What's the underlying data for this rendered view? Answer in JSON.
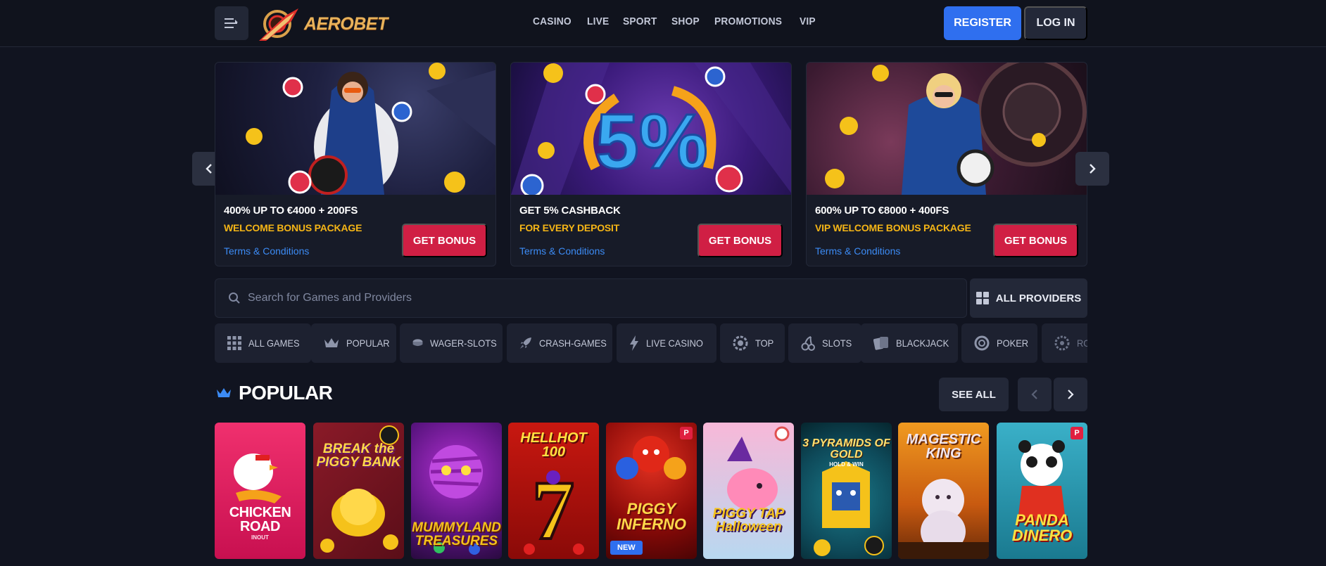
{
  "header": {
    "logo_text": "AEROBET",
    "nav": [
      "CASINO",
      "LIVE",
      "SPORT",
      "SHOP",
      "PROMOTIONS",
      "VIP"
    ],
    "register_label": "REGISTER",
    "login_label": "LOG IN"
  },
  "promos": [
    {
      "title": "400% UP TO €4000 + 200FS",
      "subtitle": "WELCOME BONUS PACKAGE",
      "terms": "Terms & Conditions",
      "button": "GET BONUS"
    },
    {
      "title": "GET 5% CASHBACK",
      "subtitle": "FOR EVERY DEPOSIT",
      "terms": "Terms & Conditions",
      "button": "GET BONUS",
      "image_text": "5%"
    },
    {
      "title": "600% UP TO €8000 + 400FS",
      "subtitle": "VIP WELCOME BONUS PACKAGE",
      "terms": "Terms & Conditions",
      "button": "GET BONUS"
    }
  ],
  "search": {
    "placeholder": "Search for Games and Providers"
  },
  "providers_label": "ALL PROVIDERS",
  "categories": [
    {
      "label": "ALL GAMES",
      "icon": "grid-icon"
    },
    {
      "label": "POPULAR",
      "icon": "crown-icon"
    },
    {
      "label": "WAGER-SLOTS",
      "icon": "coin-stack-icon"
    },
    {
      "label": "CRASH-GAMES",
      "icon": "rocket-icon"
    },
    {
      "label": "LIVE CASINO",
      "icon": "lightning-icon"
    },
    {
      "label": "TOP",
      "icon": "gear-badge-icon"
    },
    {
      "label": "SLOTS",
      "icon": "cherry-icon"
    },
    {
      "label": "BLACKJACK",
      "icon": "cards-icon"
    },
    {
      "label": "POKER",
      "icon": "chip-icon"
    },
    {
      "label": "RO",
      "icon": "roulette-icon"
    }
  ],
  "popular": {
    "title": "POPULAR",
    "see_all": "SEE ALL",
    "games": [
      {
        "name": "CHICKEN ROAD",
        "provider": "INOUT",
        "bg": "#e8246a"
      },
      {
        "name": "BREAK the PIGGY BANK",
        "bg": "#7a1420"
      },
      {
        "name": "MUMMYLAND TREASURES",
        "bg": "#4a1470"
      },
      {
        "name": "HELLHOT 100",
        "bg": "#b01410"
      },
      {
        "name": "PIGGY INFERNO",
        "bg": "#8c1010",
        "badge": "NEW"
      },
      {
        "name": "PIGGY TAP Halloween",
        "bg": "#f2a4c8"
      },
      {
        "name": "3 PYRAMIDS OF GOLD",
        "subtitle": "HOLD & WIN",
        "bg": "#0e5a6a"
      },
      {
        "name": "MAGESTIC KING",
        "bg": "#d87818"
      },
      {
        "name": "PANDA DINERO",
        "bg": "#2aa0b8"
      }
    ]
  },
  "colors": {
    "accent_blue": "#2f6fef",
    "bonus_red": "#d01f44",
    "gold": "#f5b516",
    "bg": "#111420"
  }
}
